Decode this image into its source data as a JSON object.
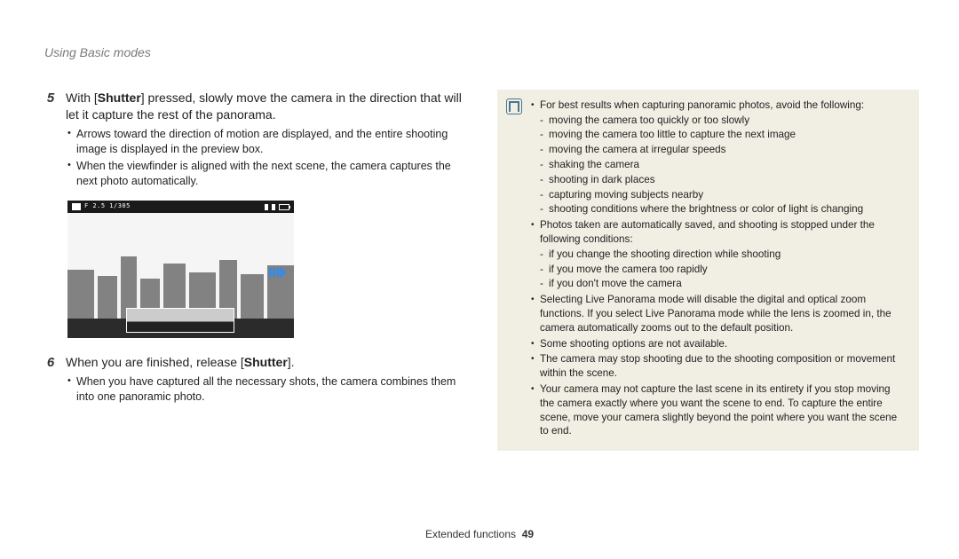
{
  "header": "Using Basic modes",
  "left": {
    "step5_num": "5",
    "step5_pre": "With [",
    "step5_bold": "Shutter",
    "step5_post": "] pressed, slowly move the camera in the direction that will let it capture the rest of the panorama.",
    "step5_bullets": [
      "Arrows toward the direction of motion are displayed, and the entire shooting image is displayed in the preview box.",
      "When the viewfinder is aligned with the next scene, the camera captures the next photo automatically."
    ],
    "preview_label": "F 2.5 1/305",
    "step6_num": "6",
    "step6_pre": "When you are finished, release [",
    "step6_bold": "Shutter",
    "step6_post": "].",
    "step6_bullets": [
      "When you have captured all the necessary shots, the camera combines them into one panoramic photo."
    ]
  },
  "noteItems": [
    {
      "text": "For best results when capturing panoramic photos, avoid the following:",
      "sub": [
        "moving the camera too quickly or too slowly",
        "moving the camera too little to capture the next image",
        "moving the camera at irregular speeds",
        "shaking the camera",
        "shooting in dark places",
        "capturing moving subjects nearby",
        "shooting conditions where the brightness or color of light is changing"
      ]
    },
    {
      "text": "Photos taken are automatically saved, and shooting is stopped under the following conditions:",
      "sub": [
        "if you change the shooting direction while shooting",
        "if you move the camera too rapidly",
        "if you don't move the camera"
      ]
    },
    {
      "text": "Selecting Live Panorama mode will disable the digital and optical zoom functions. If you select Live Panorama mode while the lens is zoomed in, the camera automatically zooms out to the default position."
    },
    {
      "text": "Some shooting options are not available."
    },
    {
      "text": "The camera may stop shooting due to the shooting composition or movement within the scene."
    },
    {
      "text": "Your camera may not capture the last scene in its entirety if you stop moving the camera exactly where you want the scene to end. To capture the entire scene, move your camera slightly beyond the point where you want the scene to end."
    }
  ],
  "footer_label": "Extended functions",
  "footer_page": "49"
}
